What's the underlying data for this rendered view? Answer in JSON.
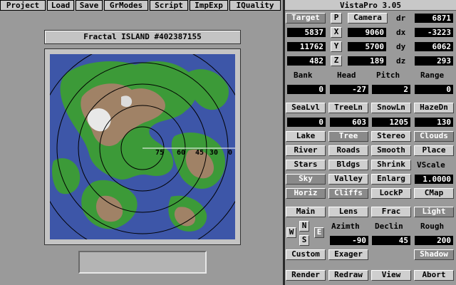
{
  "menu": [
    "Project",
    "Load",
    "Save",
    "GrModes",
    "Script",
    "ImpExp",
    "IQuality"
  ],
  "app_title": "VistaPro 3.05",
  "map": {
    "title": "Fractal ISLAND #402387155",
    "range_labels": [
      "75",
      "60",
      "45",
      "30",
      "0"
    ],
    "status_text": ""
  },
  "camera": {
    "target_label": "Target",
    "p_label": "P",
    "camera_label": "Camera",
    "dr_label": "dr",
    "dr_value": "6871",
    "x_label": "X",
    "y_label": "Y",
    "z_label": "Z",
    "dx_label": "dx",
    "dy_label": "dy",
    "dz_label": "dz",
    "target_x": "5837",
    "target_y": "11762",
    "target_z": "482",
    "camera_x": "9060",
    "camera_y": "5700",
    "camera_z": "189",
    "dx": "-3223",
    "dy": "6062",
    "dz": "293"
  },
  "orientation": {
    "bank_label": "Bank",
    "head_label": "Head",
    "pitch_label": "Pitch",
    "range_label": "Range",
    "bank": "0",
    "head": "-27",
    "pitch": "2",
    "range": "0"
  },
  "levels": {
    "sealvl_label": "SeaLvl",
    "treeln_label": "TreeLn",
    "snowln_label": "SnowLn",
    "hazedn_label": "HazeDn",
    "sealvl": "0",
    "treeln": "603",
    "snowln": "1205",
    "hazedn": "130"
  },
  "toggles": {
    "row1": [
      "Lake",
      "Tree",
      "Stereo",
      "Clouds"
    ],
    "row2": [
      "River",
      "Roads",
      "Smooth",
      "Place"
    ],
    "row3": [
      "Stars",
      "Bldgs",
      "Shrink"
    ],
    "vscale_label": "VScale",
    "row4": [
      "Sky",
      "Valley",
      "Enlarg"
    ],
    "vscale_value": "1.0000",
    "row5": [
      "Horiz",
      "Cliffs",
      "LockP",
      "CMap"
    ]
  },
  "lighting": {
    "tabs": [
      "Main",
      "Lens",
      "Frac",
      "Light"
    ],
    "compass": {
      "n": "N",
      "w": "W",
      "e": "E",
      "s": "S"
    },
    "azimuth_label": "Azimth",
    "declin_label": "Declin",
    "rough_label": "Rough",
    "azimuth": "-90",
    "declin": "45",
    "rough": "200",
    "custom_label": "Custom",
    "exager_label": "Exager",
    "shadow_label": "Shadow"
  },
  "actions": [
    "Render",
    "Redraw",
    "View",
    "Abort"
  ],
  "colors": {
    "water": "#3d56a8",
    "lowland": "#3c9a38",
    "highland": "#a08266",
    "snow": "#e8e8e8",
    "panel": "#9a9a9a"
  }
}
